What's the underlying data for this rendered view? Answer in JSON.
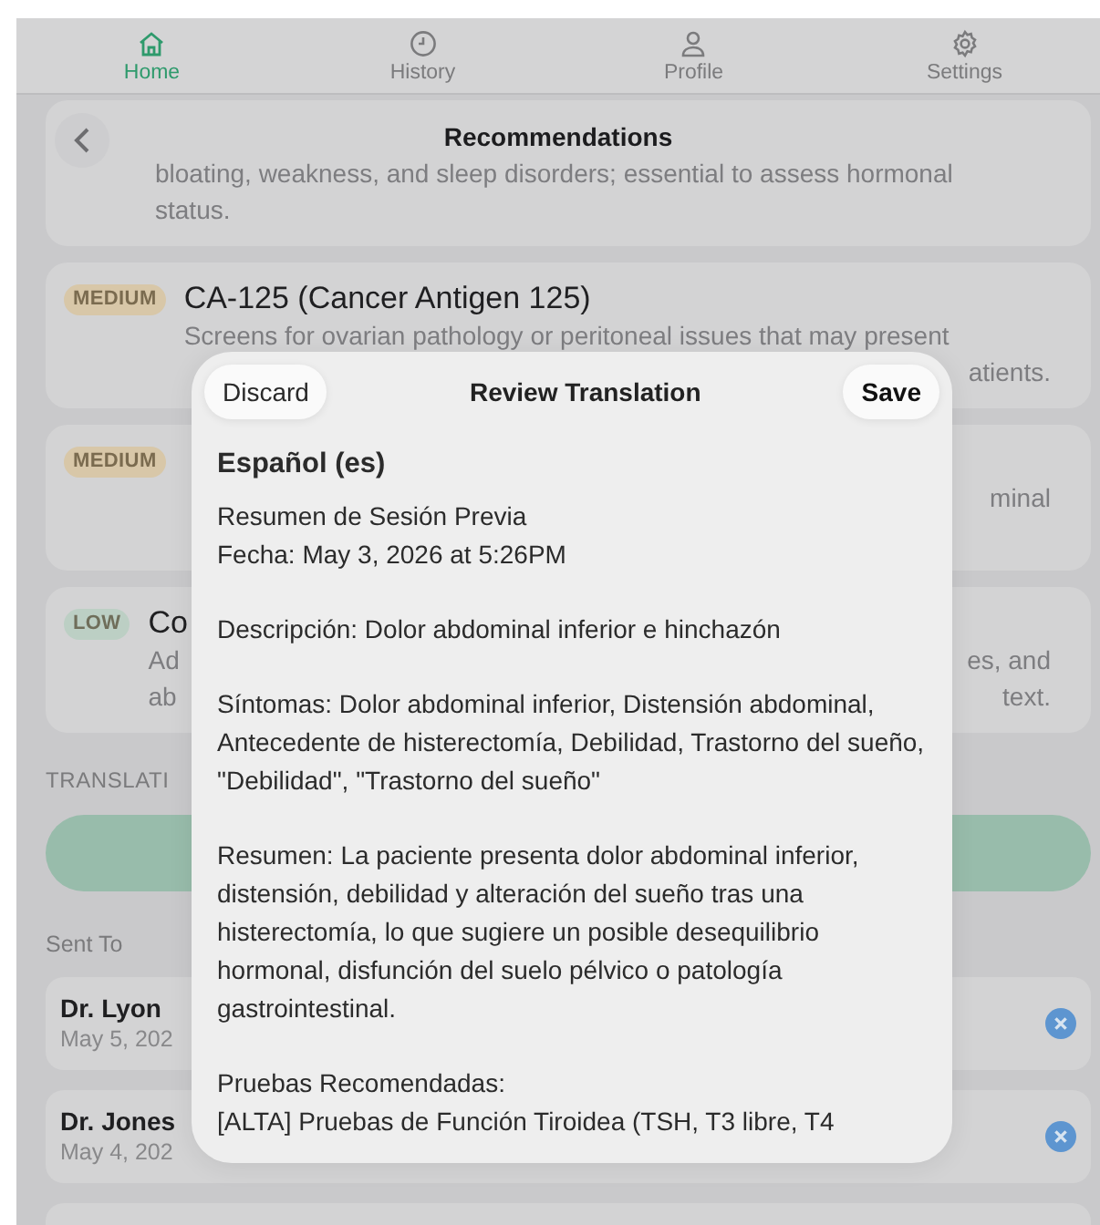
{
  "tabs": [
    {
      "label": "Home",
      "selected": true
    },
    {
      "label": "History",
      "selected": false
    },
    {
      "label": "Profile",
      "selected": false
    },
    {
      "label": "Settings",
      "selected": false
    }
  ],
  "nav": {
    "title": "Recommendations"
  },
  "recommendations": [
    {
      "rows": [
        {
          "left": "bloating, weakness, and sleep disorders; essential to assess hormonal"
        },
        {
          "left": "status."
        }
      ]
    },
    {
      "badge": {
        "text": "MEDIUM",
        "color": "#d8c7a8"
      },
      "title": "CA-125 (Cancer Antigen 125)",
      "rows": [
        {
          "left": "Screens for ovarian pathology or peritoneal issues that may present"
        },
        {
          "right": "atients."
        }
      ]
    },
    {
      "badge": {
        "text": "MEDIUM",
        "color": "#d8c7a8"
      },
      "rows": [
        {
          "right": "minal"
        }
      ]
    },
    {
      "badge": {
        "text": "LOW",
        "color": "#bccfc4"
      },
      "title": "Co",
      "rows": [
        {
          "left": "Ad",
          "right": "es, and"
        },
        {
          "left": "ab",
          "right": "text."
        }
      ]
    }
  ],
  "translation_label": "TRANSLATI",
  "sent_to": {
    "label": "Sent To",
    "doctors": [
      {
        "name": "Dr. Lyon",
        "date": "May 5, 202"
      },
      {
        "name": "Dr. Jones",
        "date": "May 4, 202"
      }
    ]
  },
  "sheet": {
    "discard": "Discard",
    "title": "Review Translation",
    "save": "Save",
    "language": "Español (es)",
    "paragraphs": [
      "Resumen de Sesión Previa\nFecha: May 3, 2026 at 5:26PM",
      "Descripción: Dolor abdominal inferior e hinchazón",
      "Síntomas: Dolor abdominal inferior, Distensión abdominal, Antecedente de histerectomía, Debilidad, Trastorno del sueño, \"Debilidad\", \"Trastorno del sueño\"",
      "Resumen: La paciente presenta dolor abdominal inferior, distensión, debilidad y alteración del sueño tras una histerectomía, lo que sugiere un posible desequilibrio hormonal, disfunción del suelo pélvico o patología gastrointestinal.",
      "Pruebas Recomendadas:\n[ALTA] Pruebas de Función Tiroidea (TSH, T3 libre, T4"
    ]
  }
}
